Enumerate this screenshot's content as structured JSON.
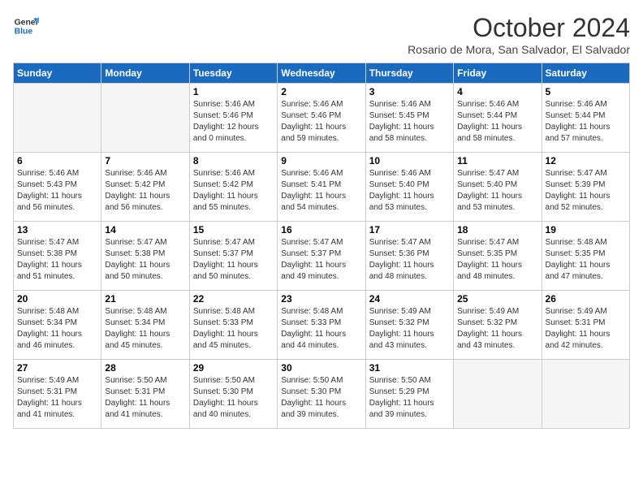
{
  "header": {
    "logo_line1": "General",
    "logo_line2": "Blue",
    "month_title": "October 2024",
    "subtitle": "Rosario de Mora, San Salvador, El Salvador"
  },
  "weekdays": [
    "Sunday",
    "Monday",
    "Tuesday",
    "Wednesday",
    "Thursday",
    "Friday",
    "Saturday"
  ],
  "weeks": [
    [
      {
        "day": "",
        "info": ""
      },
      {
        "day": "",
        "info": ""
      },
      {
        "day": "1",
        "info": "Sunrise: 5:46 AM\nSunset: 5:46 PM\nDaylight: 12 hours\nand 0 minutes."
      },
      {
        "day": "2",
        "info": "Sunrise: 5:46 AM\nSunset: 5:46 PM\nDaylight: 11 hours\nand 59 minutes."
      },
      {
        "day": "3",
        "info": "Sunrise: 5:46 AM\nSunset: 5:45 PM\nDaylight: 11 hours\nand 58 minutes."
      },
      {
        "day": "4",
        "info": "Sunrise: 5:46 AM\nSunset: 5:44 PM\nDaylight: 11 hours\nand 58 minutes."
      },
      {
        "day": "5",
        "info": "Sunrise: 5:46 AM\nSunset: 5:44 PM\nDaylight: 11 hours\nand 57 minutes."
      }
    ],
    [
      {
        "day": "6",
        "info": "Sunrise: 5:46 AM\nSunset: 5:43 PM\nDaylight: 11 hours\nand 56 minutes."
      },
      {
        "day": "7",
        "info": "Sunrise: 5:46 AM\nSunset: 5:42 PM\nDaylight: 11 hours\nand 56 minutes."
      },
      {
        "day": "8",
        "info": "Sunrise: 5:46 AM\nSunset: 5:42 PM\nDaylight: 11 hours\nand 55 minutes."
      },
      {
        "day": "9",
        "info": "Sunrise: 5:46 AM\nSunset: 5:41 PM\nDaylight: 11 hours\nand 54 minutes."
      },
      {
        "day": "10",
        "info": "Sunrise: 5:46 AM\nSunset: 5:40 PM\nDaylight: 11 hours\nand 53 minutes."
      },
      {
        "day": "11",
        "info": "Sunrise: 5:47 AM\nSunset: 5:40 PM\nDaylight: 11 hours\nand 53 minutes."
      },
      {
        "day": "12",
        "info": "Sunrise: 5:47 AM\nSunset: 5:39 PM\nDaylight: 11 hours\nand 52 minutes."
      }
    ],
    [
      {
        "day": "13",
        "info": "Sunrise: 5:47 AM\nSunset: 5:38 PM\nDaylight: 11 hours\nand 51 minutes."
      },
      {
        "day": "14",
        "info": "Sunrise: 5:47 AM\nSunset: 5:38 PM\nDaylight: 11 hours\nand 50 minutes."
      },
      {
        "day": "15",
        "info": "Sunrise: 5:47 AM\nSunset: 5:37 PM\nDaylight: 11 hours\nand 50 minutes."
      },
      {
        "day": "16",
        "info": "Sunrise: 5:47 AM\nSunset: 5:37 PM\nDaylight: 11 hours\nand 49 minutes."
      },
      {
        "day": "17",
        "info": "Sunrise: 5:47 AM\nSunset: 5:36 PM\nDaylight: 11 hours\nand 48 minutes."
      },
      {
        "day": "18",
        "info": "Sunrise: 5:47 AM\nSunset: 5:35 PM\nDaylight: 11 hours\nand 48 minutes."
      },
      {
        "day": "19",
        "info": "Sunrise: 5:48 AM\nSunset: 5:35 PM\nDaylight: 11 hours\nand 47 minutes."
      }
    ],
    [
      {
        "day": "20",
        "info": "Sunrise: 5:48 AM\nSunset: 5:34 PM\nDaylight: 11 hours\nand 46 minutes."
      },
      {
        "day": "21",
        "info": "Sunrise: 5:48 AM\nSunset: 5:34 PM\nDaylight: 11 hours\nand 45 minutes."
      },
      {
        "day": "22",
        "info": "Sunrise: 5:48 AM\nSunset: 5:33 PM\nDaylight: 11 hours\nand 45 minutes."
      },
      {
        "day": "23",
        "info": "Sunrise: 5:48 AM\nSunset: 5:33 PM\nDaylight: 11 hours\nand 44 minutes."
      },
      {
        "day": "24",
        "info": "Sunrise: 5:49 AM\nSunset: 5:32 PM\nDaylight: 11 hours\nand 43 minutes."
      },
      {
        "day": "25",
        "info": "Sunrise: 5:49 AM\nSunset: 5:32 PM\nDaylight: 11 hours\nand 43 minutes."
      },
      {
        "day": "26",
        "info": "Sunrise: 5:49 AM\nSunset: 5:31 PM\nDaylight: 11 hours\nand 42 minutes."
      }
    ],
    [
      {
        "day": "27",
        "info": "Sunrise: 5:49 AM\nSunset: 5:31 PM\nDaylight: 11 hours\nand 41 minutes."
      },
      {
        "day": "28",
        "info": "Sunrise: 5:50 AM\nSunset: 5:31 PM\nDaylight: 11 hours\nand 41 minutes."
      },
      {
        "day": "29",
        "info": "Sunrise: 5:50 AM\nSunset: 5:30 PM\nDaylight: 11 hours\nand 40 minutes."
      },
      {
        "day": "30",
        "info": "Sunrise: 5:50 AM\nSunset: 5:30 PM\nDaylight: 11 hours\nand 39 minutes."
      },
      {
        "day": "31",
        "info": "Sunrise: 5:50 AM\nSunset: 5:29 PM\nDaylight: 11 hours\nand 39 minutes."
      },
      {
        "day": "",
        "info": ""
      },
      {
        "day": "",
        "info": ""
      }
    ]
  ]
}
